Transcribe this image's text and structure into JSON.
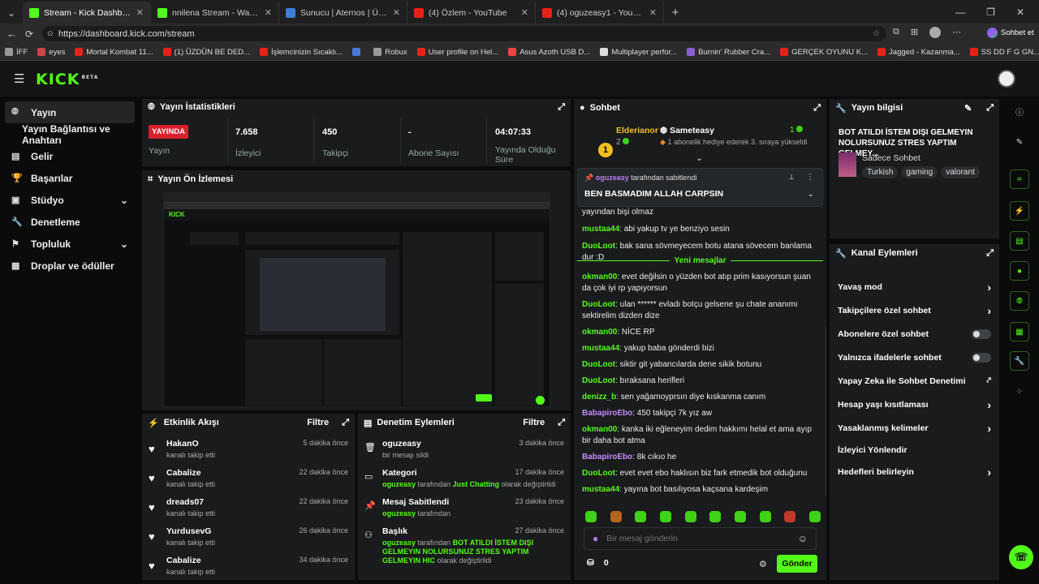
{
  "browser": {
    "tabs": [
      {
        "title": "Stream - Kick Dashboard",
        "color": "#53fc18",
        "active": true
      },
      {
        "title": "nnilena Stream - Watch Live on Ki",
        "color": "#53fc18",
        "active": false
      },
      {
        "title": "Sunucu | Aternos | Ücretsiz Minec",
        "color": "#3b7fd6",
        "active": false
      },
      {
        "title": "(4) Özlem - YouTube",
        "color": "#e62117",
        "active": false
      },
      {
        "title": "(4) oguzeasy1 - YouTube",
        "color": "#e62117",
        "active": false
      }
    ],
    "url": "https://dashboard.kick.com/stream",
    "profile_label": "Sohbet et",
    "bookmarks": [
      {
        "label": "İFF",
        "color": "#999"
      },
      {
        "label": "eyes",
        "color": "#c44"
      },
      {
        "label": "Mortal Kombat 11...",
        "color": "#e62117"
      },
      {
        "label": "(1) ÜZDÜN BE DED...",
        "color": "#e62117"
      },
      {
        "label": "İşlemcinizin Sıcaklı...",
        "color": "#e62117"
      },
      {
        "label": "",
        "color": "#4a7bd6"
      },
      {
        "label": "Robux",
        "color": "#999"
      },
      {
        "label": "User profile on Hel...",
        "color": "#e62117"
      },
      {
        "label": "Asus Azoth USB D...",
        "color": "#e44"
      },
      {
        "label": "Multiplayer perfor...",
        "color": "#ddd"
      },
      {
        "label": "Burnin' Rubber Cra...",
        "color": "#8a5fd6"
      },
      {
        "label": "GERÇEK OYUNU K...",
        "color": "#e62117"
      },
      {
        "label": "Jagged - Kazanma...",
        "color": "#e62117"
      },
      {
        "label": "SS DD F G GN...",
        "color": "#e62117"
      }
    ]
  },
  "kick": {
    "logo": "KICK",
    "logo_badge": "BETA",
    "sidebar": [
      {
        "label": "Yayın",
        "active": true
      },
      {
        "label": "Yayın Bağlantısı ve Anahtarı",
        "sub": true
      },
      {
        "label": "Gelir"
      },
      {
        "label": "Başarılar"
      },
      {
        "label": "Stüdyo",
        "chevron": true
      },
      {
        "label": "Denetleme"
      },
      {
        "label": "Topluluk",
        "chevron": true
      },
      {
        "label": "Droplar ve ödüller"
      }
    ],
    "stats": {
      "title": "Yayın İstatistikleri",
      "live_badge": "YAYINDA",
      "stream_label": "Yayın",
      "viewers_value": "7.658",
      "viewers_label": "İzleyici",
      "followers_value": "450",
      "followers_label": "Takipçi",
      "subs_value": "-",
      "subs_label": "Abone Sayısı",
      "duration_value": "04:07:33",
      "duration_label": "Yayında Olduğu Süre"
    },
    "preview": {
      "title": "Yayın Ön İzlemesi"
    },
    "activity": {
      "title": "Etkinlik Akışı",
      "filter": "Filtre",
      "items": [
        {
          "name": "HakanO",
          "desc": "kanalı takip etti",
          "time": "5 dakika önce"
        },
        {
          "name": "Cabalize",
          "desc": "kanalı takip etti",
          "time": "22 dakika önce"
        },
        {
          "name": "dreads07",
          "desc": "kanalı takip etti",
          "time": "22 dakika önce"
        },
        {
          "name": "YurdusevG",
          "desc": "kanalı takip etti",
          "time": "26 dakika önce"
        },
        {
          "name": "Cabalize",
          "desc": "kanalı takip etti",
          "time": "34 dakika önce"
        }
      ]
    },
    "modactions": {
      "title": "Denetim Eylemleri",
      "filter": "Filtre",
      "items": [
        {
          "title": "oguzeasy",
          "time": "3 dakika önce",
          "pre": "",
          "user": "",
          "mid": "bir mesajı sildi",
          "hl": "",
          "post": ""
        },
        {
          "title": "Kategori",
          "time": "17 dakika önce",
          "pre": "",
          "user": "oguzeasy",
          "mid": " tarafından ",
          "hl": "Just Chatting",
          "post": " olarak değiştirildi"
        },
        {
          "title": "Mesaj Sabitlendi",
          "time": "23 dakika önce",
          "pre": "",
          "user": "oguzeasy",
          "mid": " tarafından",
          "hl": "",
          "post": ""
        },
        {
          "title": "Başlık",
          "time": "27 dakika önce",
          "pre": "",
          "user": "oguzeasy",
          "mid": " tarafından ",
          "hl": "BOT ATILDI İSTEM DIŞI GELMEYIN NOLURSUNUZ STRES YAPTIM GELMEYIN HIC",
          "post": " olarak değiştirildi"
        }
      ]
    },
    "chat": {
      "title": "Sohbet",
      "gift_user": "Elderianor",
      "gift_count": "2",
      "gift_target": "Sameteasy",
      "gift_target_count": "1",
      "gift_text": "1 abonelik hediye ederek 3. sıraya yükseldi",
      "pinned_by_user": "oguzeasy",
      "pinned_by_text": "tarafından sabitlendi",
      "pinned_msg": "BEN BASMADIM ALLAH CARPSIN",
      "new_messages": "Yeni mesajlar",
      "messages_before": [
        {
          "user": "",
          "text": "yayından bişi olmaz"
        },
        {
          "user": "mustaa44",
          "text": "abi yakup tv ye benziyo sesin"
        },
        {
          "user": "DuoLoot",
          "text": "bak sana sövmeyecem botu atana sövecem banlama dur :D"
        }
      ],
      "messages": [
        {
          "user": "okman00",
          "text": "evet değilsin o yüzden bot atıp prim kasıyorsun şuan da çok iyi rp yapıyorsun",
          "purple": false
        },
        {
          "user": "DuoLoot",
          "text": "ulan ****** evladı botçu gelsene şu chate ananımı sektirelim dizden dize",
          "purple": false
        },
        {
          "user": "okman00",
          "text": "NİCE RP",
          "purple": false
        },
        {
          "user": "mustaa44",
          "text": "yakup baba gönderdi bizi",
          "purple": false
        },
        {
          "user": "DuoLoot",
          "text": "siktir git yabancılarda dene sikik botunu",
          "purple": false
        },
        {
          "user": "DuoLoot",
          "text": "bıraksana herifleri",
          "purple": false
        },
        {
          "user": "denizz_b",
          "text": "sen yağamoyprsın diye kıskanma canım",
          "purple": false
        },
        {
          "user": "BabapiroEbo",
          "text": "450 takipçi 7k yız aw",
          "purple": true
        },
        {
          "user": "okman00",
          "text": "kanka iki eğleneyim dedim hakkımı helal et ama ayıp bir daha bot atma",
          "purple": false
        },
        {
          "user": "BabapiroEbo",
          "text": "8k cıkıo he",
          "purple": true
        },
        {
          "user": "DuoLoot",
          "text": "evet evet ebo haklısın biz fark etmedik bot olduğunu",
          "purple": false
        },
        {
          "user": "mustaa44",
          "text": "yayına bot basılıyosa kaçsana kardeşim",
          "purple": false
        }
      ],
      "input_placeholder": "Bir mesaj gönderin",
      "points": "0",
      "send": "Gönder"
    },
    "info": {
      "title": "Yayın bilgisi",
      "stream_title": "BOT ATILDI İSTEM DIŞI GELMEYIN NOLURSUNUZ STRES YAPTIM GELMEY...",
      "category": "Sadece Sohbet",
      "tags": [
        "Turkish",
        "gaming",
        "valorant"
      ]
    },
    "channel_actions": {
      "title": "Kanal Eylemleri",
      "items": [
        {
          "label": "Yavaş mod",
          "type": "chevron"
        },
        {
          "label": "Takipçilere özel sohbet",
          "type": "chevron"
        },
        {
          "label": "Abonelere özel sohbet",
          "type": "toggle"
        },
        {
          "label": "Yalnızca ifadelerle sohbet",
          "type": "toggle"
        },
        {
          "label": "Yapay Zeka ile Sohbet Denetimi",
          "type": "external"
        },
        {
          "label": "Hesap yaşı kısıtlaması",
          "type": "chevron"
        },
        {
          "label": "Yasaklanmış kelimeler",
          "type": "chevron"
        },
        {
          "label": "İzleyici Yönlendir",
          "type": "none"
        },
        {
          "label": "Hedefleri belirleyin",
          "type": "chevron"
        }
      ]
    }
  }
}
